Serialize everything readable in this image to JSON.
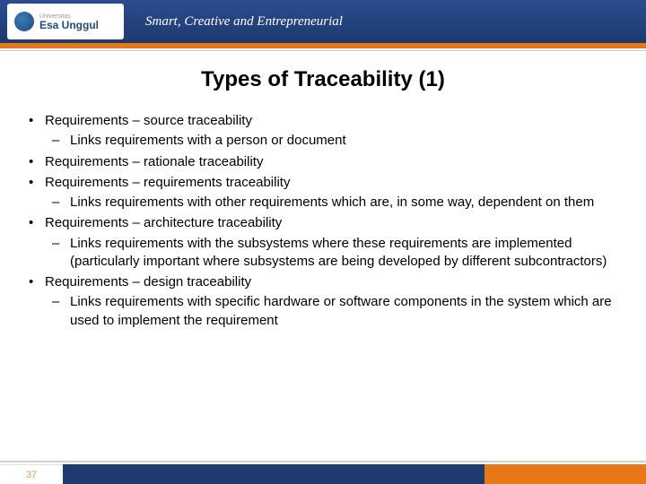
{
  "header": {
    "logo": {
      "uni_label": "Universitas",
      "name": "Esa Unggul"
    },
    "tagline": "Smart, Creative and Entrepreneurial"
  },
  "title": "Types of Traceability (1)",
  "bullets": [
    {
      "text": "Requirements – source traceability",
      "sub": [
        "Links requirements with a person or document"
      ]
    },
    {
      "text": "Requirements – rationale traceability",
      "sub": []
    },
    {
      "text": "Requirements – requirements traceability",
      "sub": [
        "Links requirements with other requirements which are, in some way, dependent on them"
      ]
    },
    {
      "text": "Requirements – architecture traceability",
      "sub": [
        "Links requirements with the subsystems where these requirements are implemented (particularly important where subsystems are being developed by different subcontractors)"
      ]
    },
    {
      "text": "Requirements – design traceability",
      "sub": [
        "Links requirements with specific hardware or software components in the system which are used to implement the requirement"
      ]
    }
  ],
  "footer": {
    "page_number": "37"
  }
}
